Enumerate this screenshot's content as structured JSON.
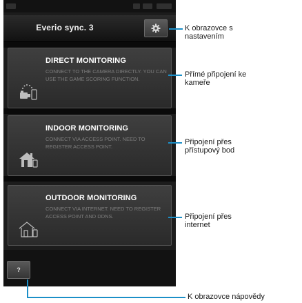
{
  "app": {
    "title": "Everio sync. 3"
  },
  "settings_button": {
    "icon": "gear-icon"
  },
  "help_button": {
    "label": "?"
  },
  "cards": [
    {
      "title": "DIRECT MONITORING",
      "description": "CONNECT TO THE CAMERA DIRECTLY. YOU CAN USE THE GAME SCORING FUNCTION.",
      "icon": "camera-phone-icon"
    },
    {
      "title": "INDOOR MONITORING",
      "description": "CONNECT VIA ACCESS POINT. NEED TO REGISTER ACCESS POINT.",
      "icon": "home-icon"
    },
    {
      "title": "OUTDOOR MONITORING",
      "description": "CONNECT VIA INTERNET. NEED TO REGISTER ACCESS POINT AND DDNS.",
      "icon": "home-outline-icon"
    }
  ],
  "callouts": {
    "settings": [
      "K obrazovce s",
      "nastavením"
    ],
    "direct": [
      "Přímé připojení ke",
      "kameře"
    ],
    "indoor": [
      "Připojení přes",
      "přístupový bod"
    ],
    "outdoor": [
      "Připojení přes",
      "internet"
    ],
    "help": [
      "K obrazovce nápovědy"
    ]
  },
  "colors": {
    "callout_line": "#1b8fc8",
    "screen_bg": "#1c1c1c",
    "card_title": "#ffffff",
    "card_desc": "#7d7d7d"
  }
}
